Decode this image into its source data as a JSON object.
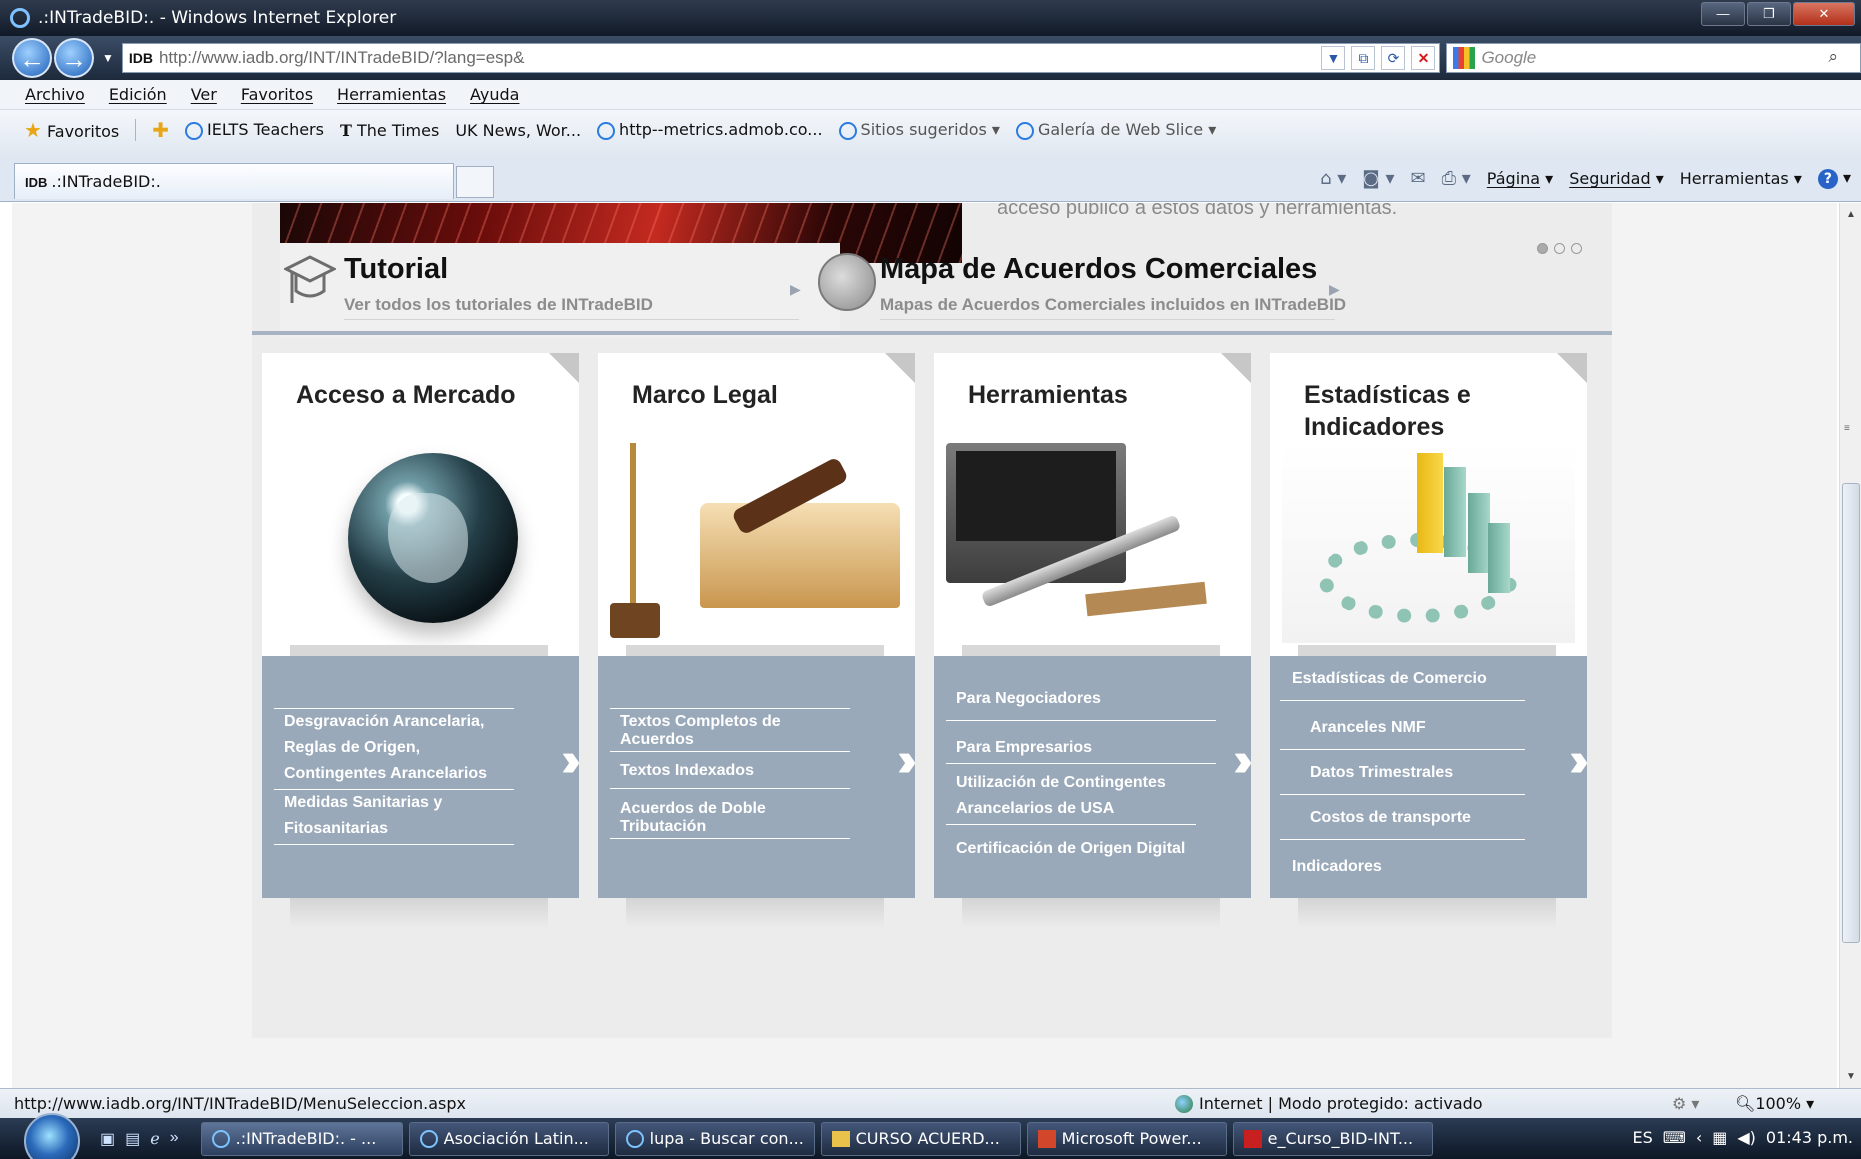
{
  "window": {
    "title": ".:INTradeBID:. - Windows Internet Explorer"
  },
  "address": {
    "site_badge": "IDB",
    "url": "http://www.iadb.org/INT/INTradeBID/?lang=esp&"
  },
  "search": {
    "placeholder": "Google"
  },
  "menu": [
    "Archivo",
    "Edición",
    "Ver",
    "Favoritos",
    "Herramientas",
    "Ayuda"
  ],
  "favorites": {
    "label": "Favoritos",
    "items": [
      "IELTS Teachers",
      "The Times",
      "UK News, Wor...",
      "http--metrics.admob.co...",
      "Sitios sugeridos",
      "Galería de Web Slice"
    ]
  },
  "tab": {
    "badge": "IDB",
    "label": ".:INTradeBID:."
  },
  "command_bar": {
    "page": "Página",
    "security": "Seguridad",
    "tools": "Herramientas"
  },
  "page": {
    "hero_text": "acceso público a estos datos y herramientas.",
    "tutorial": {
      "title": "Tutorial",
      "subtitle": "Ver todos los tutoriales de INTradeBID"
    },
    "map": {
      "title": "Mapa de Acuerdos Comerciales",
      "subtitle": "Mapas de Acuerdos Comerciales incluidos en INTradeBID"
    },
    "cards": [
      {
        "title": "Acceso a Mercado",
        "links": [
          "Desgravación Arancelaria, Reglas de Origen, Contingentes Arancelarios",
          "Medidas Sanitarias y Fitosanitarias"
        ]
      },
      {
        "title": "Marco Legal",
        "links": [
          "Textos Completos de Acuerdos",
          "Textos Indexados",
          "Acuerdos de Doble Tributación"
        ]
      },
      {
        "title": "Herramientas",
        "links": [
          "Para Negociadores",
          "Para Empresarios",
          "Utilización de Contingentes Arancelarios de USA",
          "Certificación de Origen Digital"
        ]
      },
      {
        "title": "Estadísticas e Indicadores",
        "links": [
          "Estadísticas de Comercio",
          "Aranceles NMF",
          "Datos Trimestrales",
          "Costos de transporte",
          "Indicadores"
        ]
      }
    ]
  },
  "status": {
    "url": "http://www.iadb.org/INT/INTradeBID/MenuSeleccion.aspx",
    "zone": "Internet | Modo protegido: activado",
    "zoom": "100%"
  },
  "taskbar": {
    "items": [
      ".:INTradeBID:. - ...",
      "Asociación Latin...",
      "lupa - Buscar con...",
      "CURSO ACUERD...",
      "Microsoft Power...",
      "e_Curso_BID-INT..."
    ],
    "lang": "ES",
    "time": "01:43 p.m."
  }
}
